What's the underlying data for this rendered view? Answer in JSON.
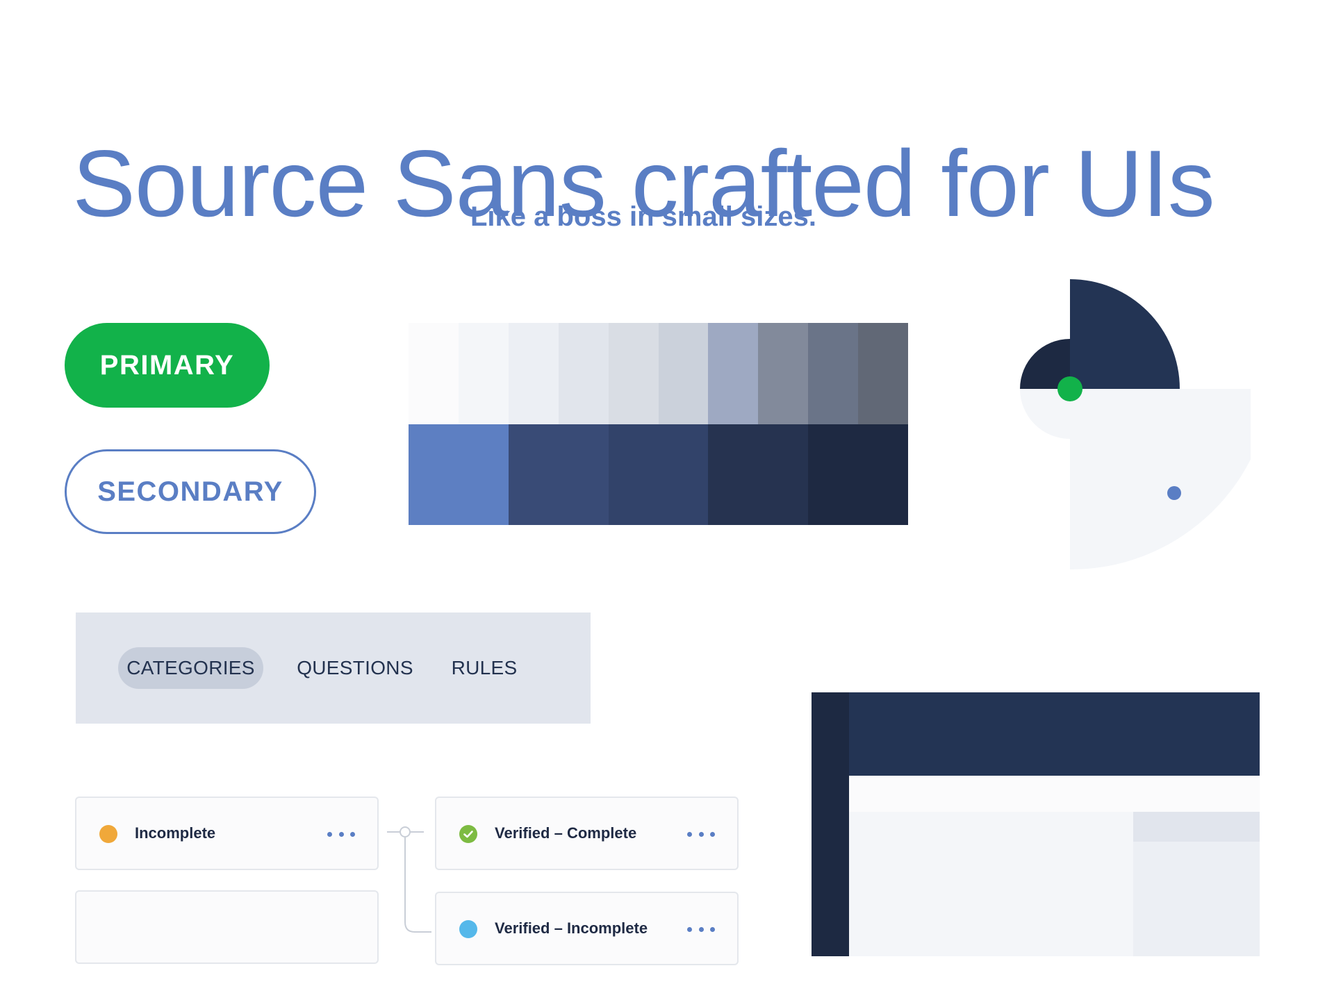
{
  "headline": {
    "title": "Source Sans crafted for UIs",
    "subtitle": "Like a boss in small sizes."
  },
  "buttons": {
    "primary_label": "PRIMARY",
    "secondary_label": "SECONDARY"
  },
  "palette": {
    "top_row": [
      "#fbfbfc",
      "#f4f6f9",
      "#eceff4",
      "#e1e5ec",
      "#d9dde4",
      "#cbd1db",
      "#9ea9c2",
      "#828a9b",
      "#6a7488",
      "#616876"
    ],
    "bottom_row": [
      "#5d7fc2",
      "#394b76",
      "#32436a",
      "#263350",
      "#1e2942"
    ]
  },
  "tabs": {
    "items": [
      {
        "label": "CATEGORIES",
        "active": true
      },
      {
        "label": "QUESTIONS",
        "active": false
      },
      {
        "label": "RULES",
        "active": false
      }
    ]
  },
  "statuses": {
    "incomplete": {
      "label": "Incomplete",
      "color": "#f0a83a"
    },
    "verified_complete": {
      "label": "Verified – Complete",
      "color": "#7dbb42"
    },
    "verified_incomplete": {
      "label": "Verified – Incomplete",
      "color": "#55b8ea"
    }
  },
  "colors": {
    "accent_blue": "#5a7ec4",
    "primary_green": "#12b24a",
    "navy": "#233454",
    "navy_dark": "#1d2942"
  }
}
